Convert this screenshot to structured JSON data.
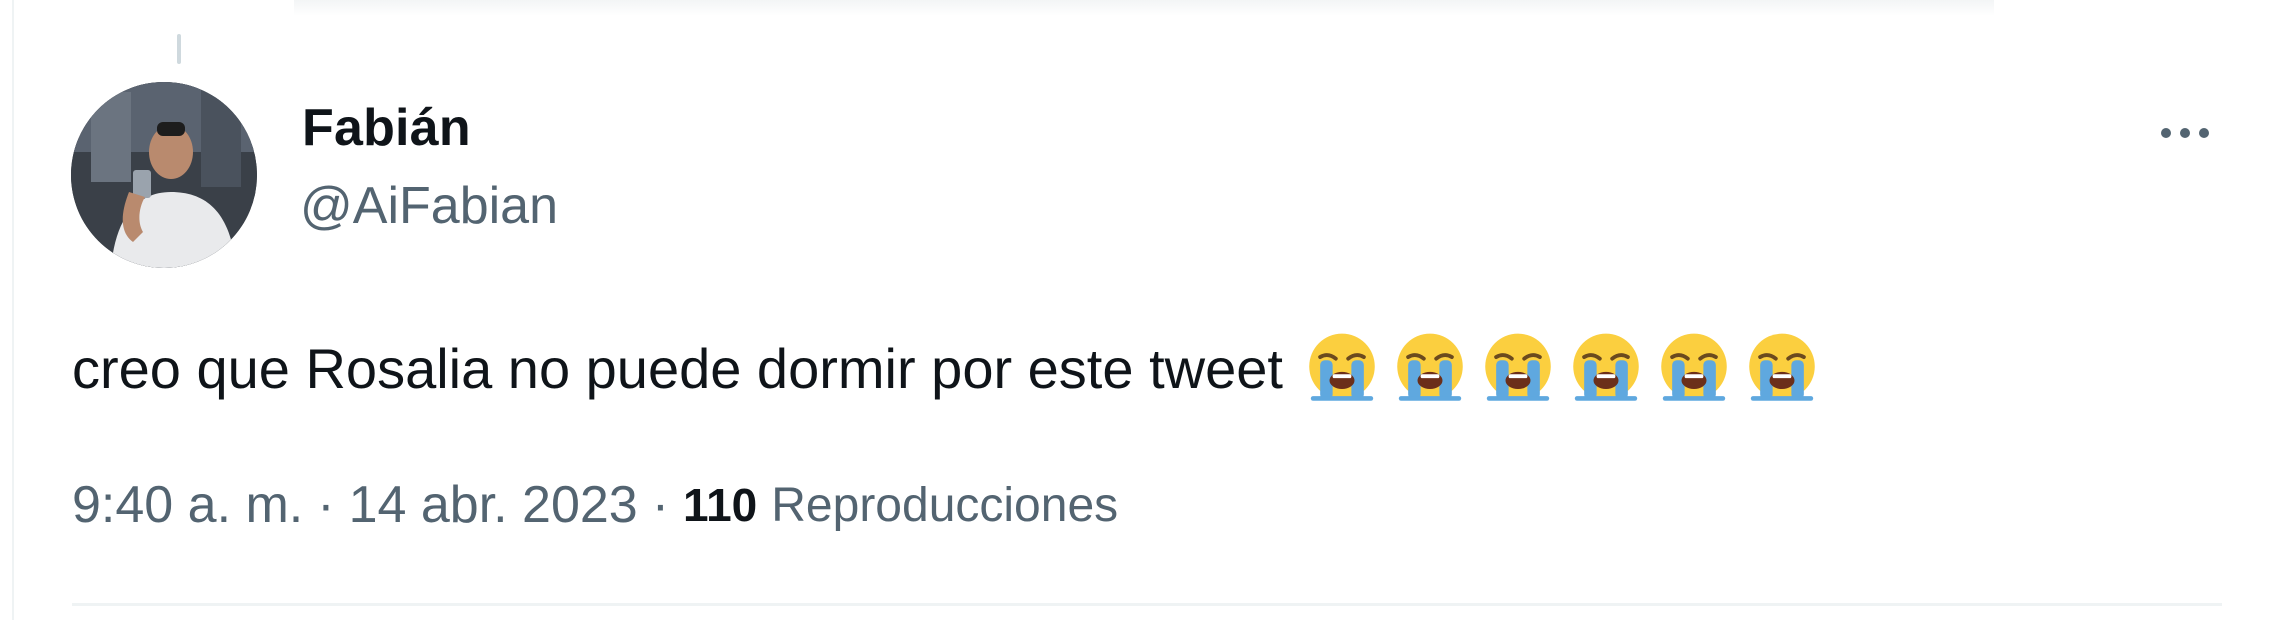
{
  "tweet": {
    "author": {
      "name": "Fabián",
      "handle": "@AiFabian",
      "avatar_icon": "profile-photo"
    },
    "text": "creo que Rosalia no puede dormir por este tweet",
    "emojis": [
      "😭",
      "😭",
      "😭",
      "😭",
      "😭",
      "😭"
    ],
    "emoji_icon": "loudly-crying-face",
    "time": "9:40 a. m.",
    "separator": "·",
    "date": "14 abr. 2023",
    "views_count": "110",
    "views_label": "Reproducciones",
    "more_icon": "more-horizontal-icon"
  },
  "colors": {
    "text_primary": "#0f1419",
    "text_secondary": "#536471",
    "divider": "#eff3f4",
    "emoji_face": "#fbcf3f",
    "emoji_tears": "#5fa8df"
  }
}
